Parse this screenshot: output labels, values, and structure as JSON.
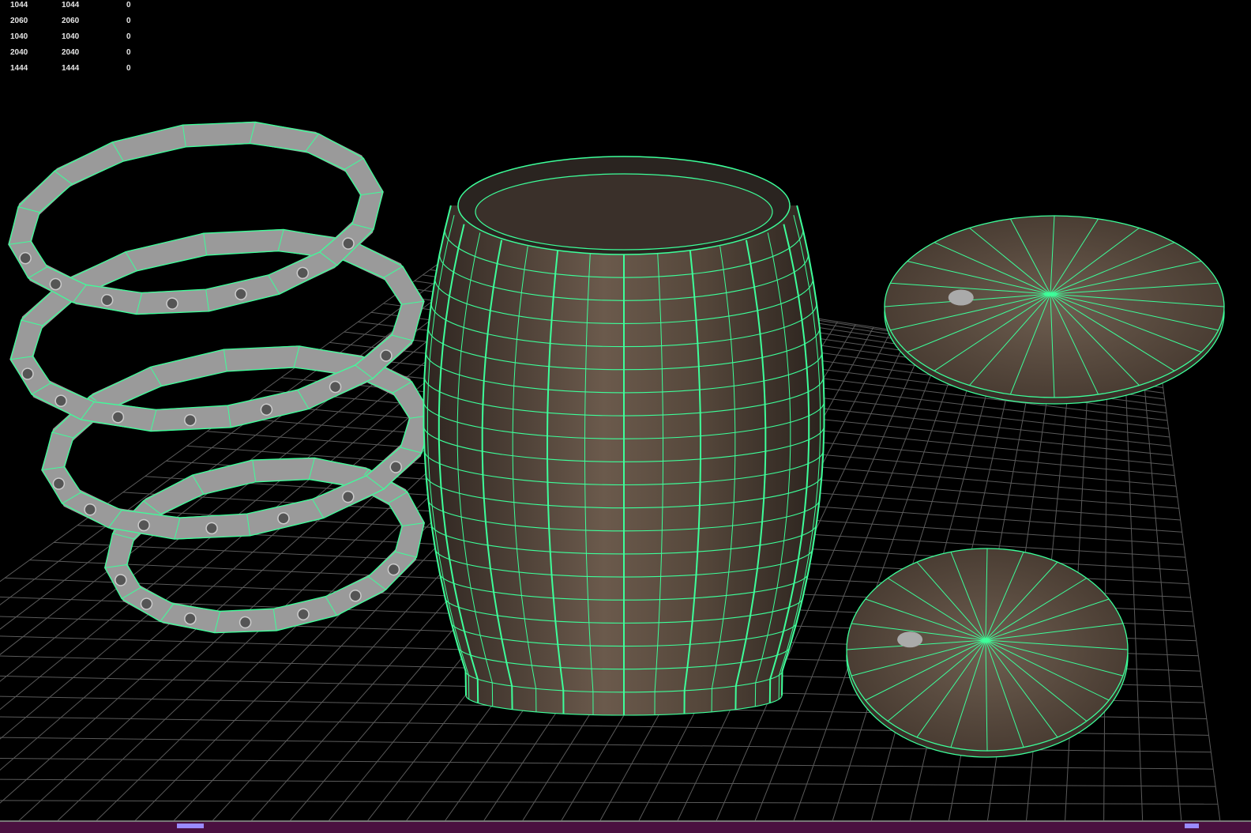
{
  "hud": {
    "rows": [
      [
        "1044",
        "1044",
        "0"
      ],
      [
        "2060",
        "2060",
        "0"
      ],
      [
        "1040",
        "1040",
        "0"
      ],
      [
        "2040",
        "2040",
        "0"
      ],
      [
        "1444",
        "1444",
        "0"
      ]
    ]
  },
  "colors": {
    "wire": "#3dff9a",
    "grid": "#5a5a5a",
    "wood": "#5b4a3e",
    "metal": "#9a9a9a",
    "background": "#000000"
  },
  "scene": {
    "objects": [
      "barrel",
      "ring",
      "ring",
      "ring",
      "ring",
      "lid",
      "lid"
    ]
  }
}
